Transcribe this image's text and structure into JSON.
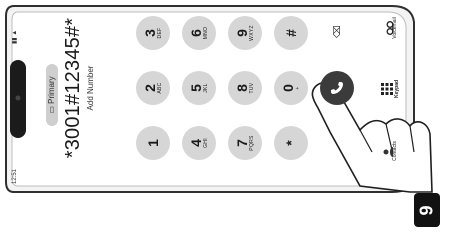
{
  "dialer": {
    "line_label": "Primary",
    "number": "*3001#12345#*",
    "add_number": "Add Number",
    "keys": [
      {
        "digit": "1",
        "letters": ""
      },
      {
        "digit": "2",
        "letters": "ABC"
      },
      {
        "digit": "3",
        "letters": "DEF"
      },
      {
        "digit": "4",
        "letters": "GHI"
      },
      {
        "digit": "5",
        "letters": "JKL"
      },
      {
        "digit": "6",
        "letters": "MNO"
      },
      {
        "digit": "7",
        "letters": "PQRS"
      },
      {
        "digit": "8",
        "letters": "TUV"
      },
      {
        "digit": "9",
        "letters": "WXYZ"
      },
      {
        "digit": "*",
        "letters": ""
      },
      {
        "digit": "0",
        "letters": "+"
      },
      {
        "digit": "#",
        "letters": ""
      }
    ],
    "bottom_tabs": {
      "voicemail": "Voicemail",
      "keypad": "Keypad",
      "contacts": "Contacts"
    }
  },
  "callout": {
    "step": "9"
  },
  "colors": {
    "phone_frame": "#2f2f2f",
    "key_bg": "#d6d6d6",
    "call_button": "#3b3b3b"
  }
}
